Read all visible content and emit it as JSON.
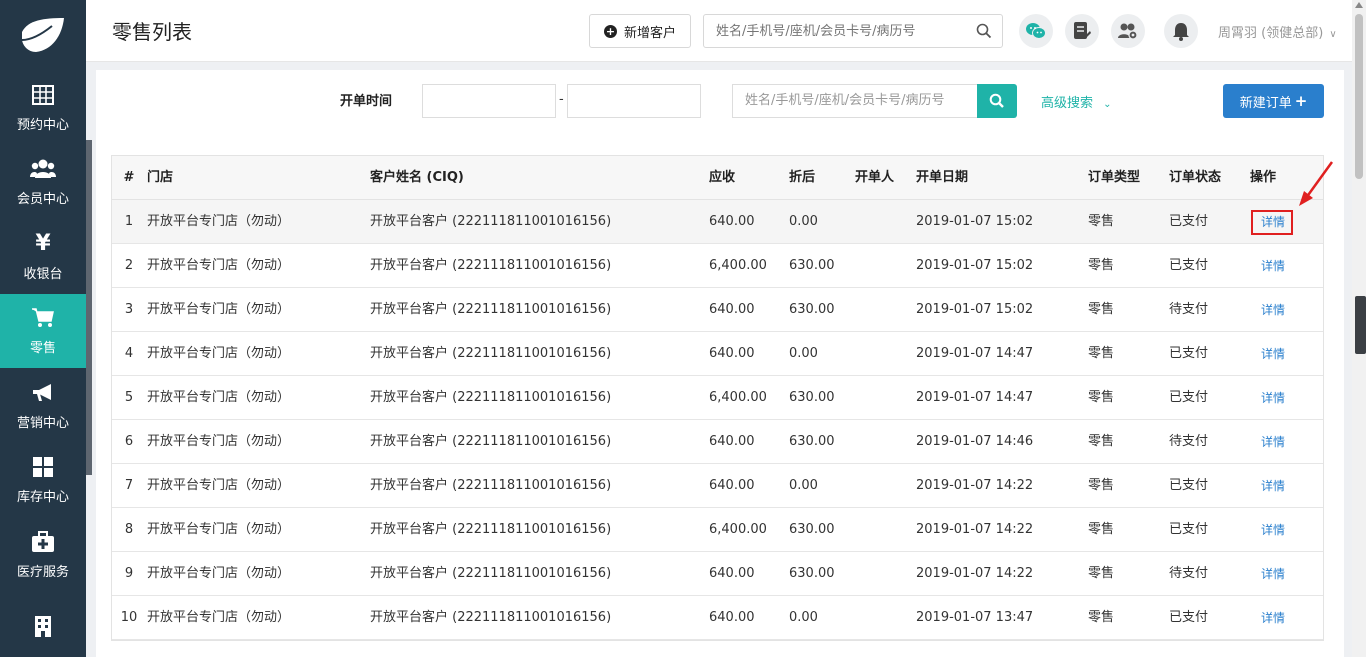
{
  "sidebar": {
    "items": [
      {
        "label": "预约中心",
        "icon": "calendar-grid-icon"
      },
      {
        "label": "会员中心",
        "icon": "members-icon"
      },
      {
        "label": "收银台",
        "icon": "yen-icon",
        "glyph": "¥"
      },
      {
        "label": "零售",
        "icon": "cart-icon",
        "active": true
      },
      {
        "label": "营销中心",
        "icon": "megaphone-icon"
      },
      {
        "label": "库存中心",
        "icon": "grid-icon"
      },
      {
        "label": "医疗服务",
        "icon": "medkit-icon"
      },
      {
        "label": "",
        "icon": "building-icon"
      }
    ]
  },
  "header": {
    "title": "零售列表",
    "add_customer_label": "新增客户",
    "search_placeholder": "姓名/手机号/座机/会员卡号/病历号",
    "user_name": "周霄羽 (领健总部)"
  },
  "filters": {
    "date_label": "开单时间",
    "date_separator": "-",
    "search_placeholder": "姓名/手机号/座机/会员卡号/病历号",
    "advanced_search_label": "高级搜索",
    "new_order_label": "新建订单"
  },
  "table": {
    "headers": {
      "num": "#",
      "store": "门店",
      "customer": "客户姓名 (CIQ)",
      "receivable": "应收",
      "discounted": "折后",
      "operator": "开单人",
      "date": "开单日期",
      "type": "订单类型",
      "status": "订单状态",
      "action": "操作"
    },
    "rows": [
      {
        "num": "1",
        "store": "开放平台专门店（勿动）",
        "customer": "开放平台客户 (222111811001016156)",
        "receivable": "640.00",
        "discounted": "0.00",
        "operator": "",
        "date": "2019-01-07 15:02",
        "type": "零售",
        "status": "已支付",
        "action": "详情"
      },
      {
        "num": "2",
        "store": "开放平台专门店（勿动）",
        "customer": "开放平台客户 (222111811001016156)",
        "receivable": "6,400.00",
        "discounted": "630.00",
        "operator": "",
        "date": "2019-01-07 15:02",
        "type": "零售",
        "status": "已支付",
        "action": "详情"
      },
      {
        "num": "3",
        "store": "开放平台专门店（勿动）",
        "customer": "开放平台客户 (222111811001016156)",
        "receivable": "640.00",
        "discounted": "630.00",
        "operator": "",
        "date": "2019-01-07 15:02",
        "type": "零售",
        "status": "待支付",
        "action": "详情"
      },
      {
        "num": "4",
        "store": "开放平台专门店（勿动）",
        "customer": "开放平台客户 (222111811001016156)",
        "receivable": "640.00",
        "discounted": "0.00",
        "operator": "",
        "date": "2019-01-07 14:47",
        "type": "零售",
        "status": "已支付",
        "action": "详情"
      },
      {
        "num": "5",
        "store": "开放平台专门店（勿动）",
        "customer": "开放平台客户 (222111811001016156)",
        "receivable": "6,400.00",
        "discounted": "630.00",
        "operator": "",
        "date": "2019-01-07 14:47",
        "type": "零售",
        "status": "已支付",
        "action": "详情"
      },
      {
        "num": "6",
        "store": "开放平台专门店（勿动）",
        "customer": "开放平台客户 (222111811001016156)",
        "receivable": "640.00",
        "discounted": "630.00",
        "operator": "",
        "date": "2019-01-07 14:46",
        "type": "零售",
        "status": "待支付",
        "action": "详情"
      },
      {
        "num": "7",
        "store": "开放平台专门店（勿动）",
        "customer": "开放平台客户 (222111811001016156)",
        "receivable": "640.00",
        "discounted": "0.00",
        "operator": "",
        "date": "2019-01-07 14:22",
        "type": "零售",
        "status": "已支付",
        "action": "详情"
      },
      {
        "num": "8",
        "store": "开放平台专门店（勿动）",
        "customer": "开放平台客户 (222111811001016156)",
        "receivable": "6,400.00",
        "discounted": "630.00",
        "operator": "",
        "date": "2019-01-07 14:22",
        "type": "零售",
        "status": "已支付",
        "action": "详情"
      },
      {
        "num": "9",
        "store": "开放平台专门店（勿动）",
        "customer": "开放平台客户 (222111811001016156)",
        "receivable": "640.00",
        "discounted": "630.00",
        "operator": "",
        "date": "2019-01-07 14:22",
        "type": "零售",
        "status": "待支付",
        "action": "详情"
      },
      {
        "num": "10",
        "store": "开放平台专门店（勿动）",
        "customer": "开放平台客户 (222111811001016156)",
        "receivable": "640.00",
        "discounted": "0.00",
        "operator": "",
        "date": "2019-01-07 13:47",
        "type": "零售",
        "status": "已支付",
        "action": "详情"
      }
    ]
  },
  "colors": {
    "sidebar_bg": "#243747",
    "accent_teal": "#1fb3a8",
    "primary_blue": "#2a7fcd",
    "annotation_red": "#e02020"
  }
}
